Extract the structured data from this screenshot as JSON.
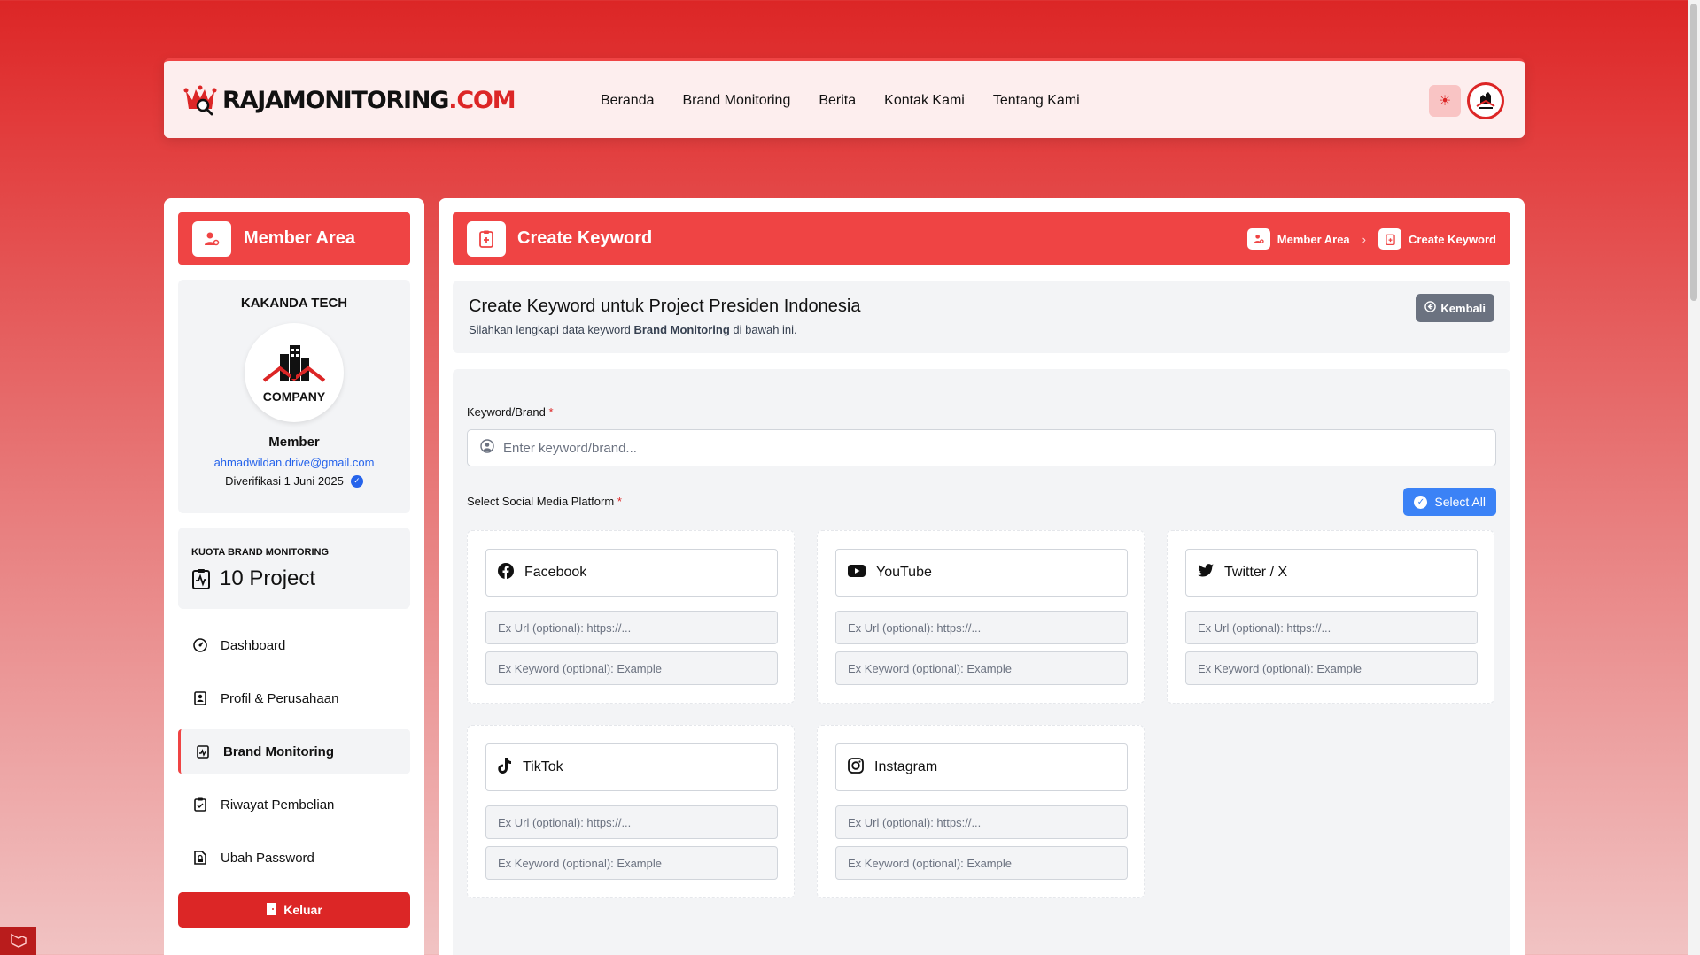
{
  "brand": {
    "name_main": "RAJAMONITORING",
    "name_suffix": ".COM"
  },
  "nav": {
    "links": [
      "Beranda",
      "Brand Monitoring",
      "Berita",
      "Kontak Kami",
      "Tentang Kami"
    ],
    "theme_icon": "sun-icon",
    "avatar_icon": "company-logo"
  },
  "sidebar": {
    "title": "Member Area",
    "company": "KAKANDA TECH",
    "logo_text": "COMPANY",
    "role": "Member",
    "email": "ahmadwildan.drive@gmail.com",
    "verified": "Diverifikasi 1 Juni 2025",
    "quota_label": "Kuota Brand Monitoring",
    "quota_value": "10 Project",
    "menu": [
      {
        "label": "Dashboard",
        "icon": "dashboard-icon"
      },
      {
        "label": "Profil & Perusahaan",
        "icon": "profile-icon"
      },
      {
        "label": "Brand Monitoring",
        "icon": "brand-monitoring-icon",
        "active": true
      },
      {
        "label": "Riwayat Pembelian",
        "icon": "clipboard-icon"
      },
      {
        "label": "Ubah Password",
        "icon": "lock-file-icon"
      }
    ],
    "logout": "Keluar"
  },
  "main": {
    "title": "Create Keyword",
    "breadcrumb": [
      "Member Area",
      "Create Keyword"
    ],
    "heading": "Create Keyword untuk Project Presiden Indonesia",
    "sub_before": "Silahkan lengkapi data keyword ",
    "sub_bold": "Brand Monitoring",
    "sub_after": " di bawah ini.",
    "back": "Kembali",
    "keyword_label": "Keyword/Brand",
    "required_mark": "*",
    "keyword_placeholder": "Enter keyword/brand...",
    "platform_label": "Select Social Media Platform",
    "select_all": "Select All",
    "platforms": [
      {
        "name": "Facebook",
        "icon": "facebook-icon"
      },
      {
        "name": "YouTube",
        "icon": "youtube-icon"
      },
      {
        "name": "Twitter / X",
        "icon": "twitter-icon"
      },
      {
        "name": "TikTok",
        "icon": "tiktok-icon"
      },
      {
        "name": "Instagram",
        "icon": "instagram-icon"
      }
    ],
    "url_placeholder": "Ex Url (optional): https://...",
    "keyword_field_placeholder": "Ex Keyword (optional): Example"
  },
  "colors": {
    "primary": "#ef4444",
    "dark_red": "#dc2626",
    "blue": "#3b82f6",
    "gray": "#6b7280"
  }
}
